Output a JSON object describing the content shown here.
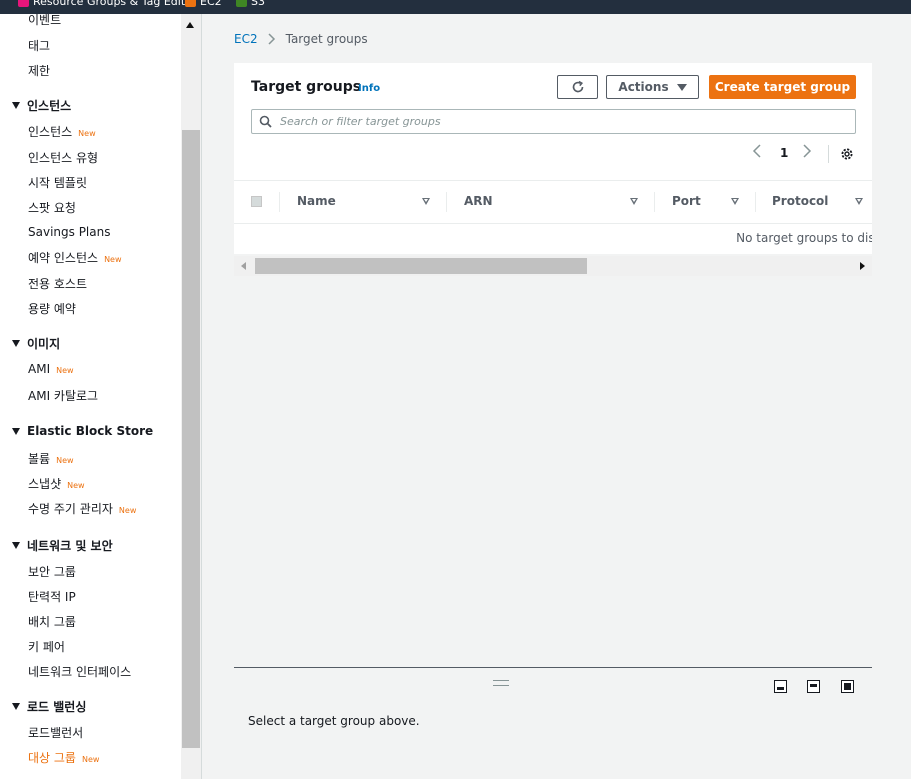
{
  "topbar": {
    "favorites": [
      {
        "label": "Resource Groups & Tag Editor",
        "icon": "resource-groups-icon",
        "color": "#e7157b"
      },
      {
        "label": "EC2",
        "icon": "ec2-icon",
        "color": "#ec7211"
      },
      {
        "label": "S3",
        "icon": "s3-icon",
        "color": "#3f8624"
      }
    ]
  },
  "sidebar": {
    "top_items": [
      "이벤트",
      "태그",
      "제한"
    ],
    "new_badge": "New",
    "sections": [
      {
        "title": "인스턴스",
        "items": [
          {
            "label": "인스턴스",
            "new": true
          },
          {
            "label": "인스턴스 유형"
          },
          {
            "label": "시작 템플릿"
          },
          {
            "label": "스팟 요청"
          },
          {
            "label": "Savings Plans"
          },
          {
            "label": "예약 인스턴스",
            "new": true
          },
          {
            "label": "전용 호스트"
          },
          {
            "label": "용량 예약"
          }
        ]
      },
      {
        "title": "이미지",
        "items": [
          {
            "label": "AMI",
            "new": true
          },
          {
            "label": "AMI 카탈로그"
          }
        ]
      },
      {
        "title": "Elastic Block Store",
        "items": [
          {
            "label": "볼륨",
            "new": true
          },
          {
            "label": "스냅샷",
            "new": true
          },
          {
            "label": "수명 주기 관리자",
            "new": true
          }
        ]
      },
      {
        "title": "네트워크 및 보안",
        "items": [
          {
            "label": "보안 그룹"
          },
          {
            "label": "탄력적 IP"
          },
          {
            "label": "배치 그룹"
          },
          {
            "label": "키 페어"
          },
          {
            "label": "네트워크 인터페이스"
          }
        ]
      },
      {
        "title": "로드 밸런싱",
        "items": [
          {
            "label": "로드밸런서"
          },
          {
            "label": "대상 그룹",
            "new": true,
            "active": true
          }
        ]
      }
    ]
  },
  "breadcrumb": {
    "root": "EC2",
    "current": "Target groups"
  },
  "panel": {
    "title": "Target groups",
    "info": "Info",
    "actions_label": "Actions",
    "create_label": "Create target group",
    "search_placeholder": "Search or filter target groups",
    "page": "1",
    "columns": [
      "Name",
      "ARN",
      "Port",
      "Protocol"
    ],
    "empty_message": "No target groups to display"
  },
  "detail": {
    "message": "Select a target group above."
  },
  "colors": {
    "accent": "#ec7211",
    "link": "#0073bb",
    "nav_bg": "#232f3e"
  }
}
